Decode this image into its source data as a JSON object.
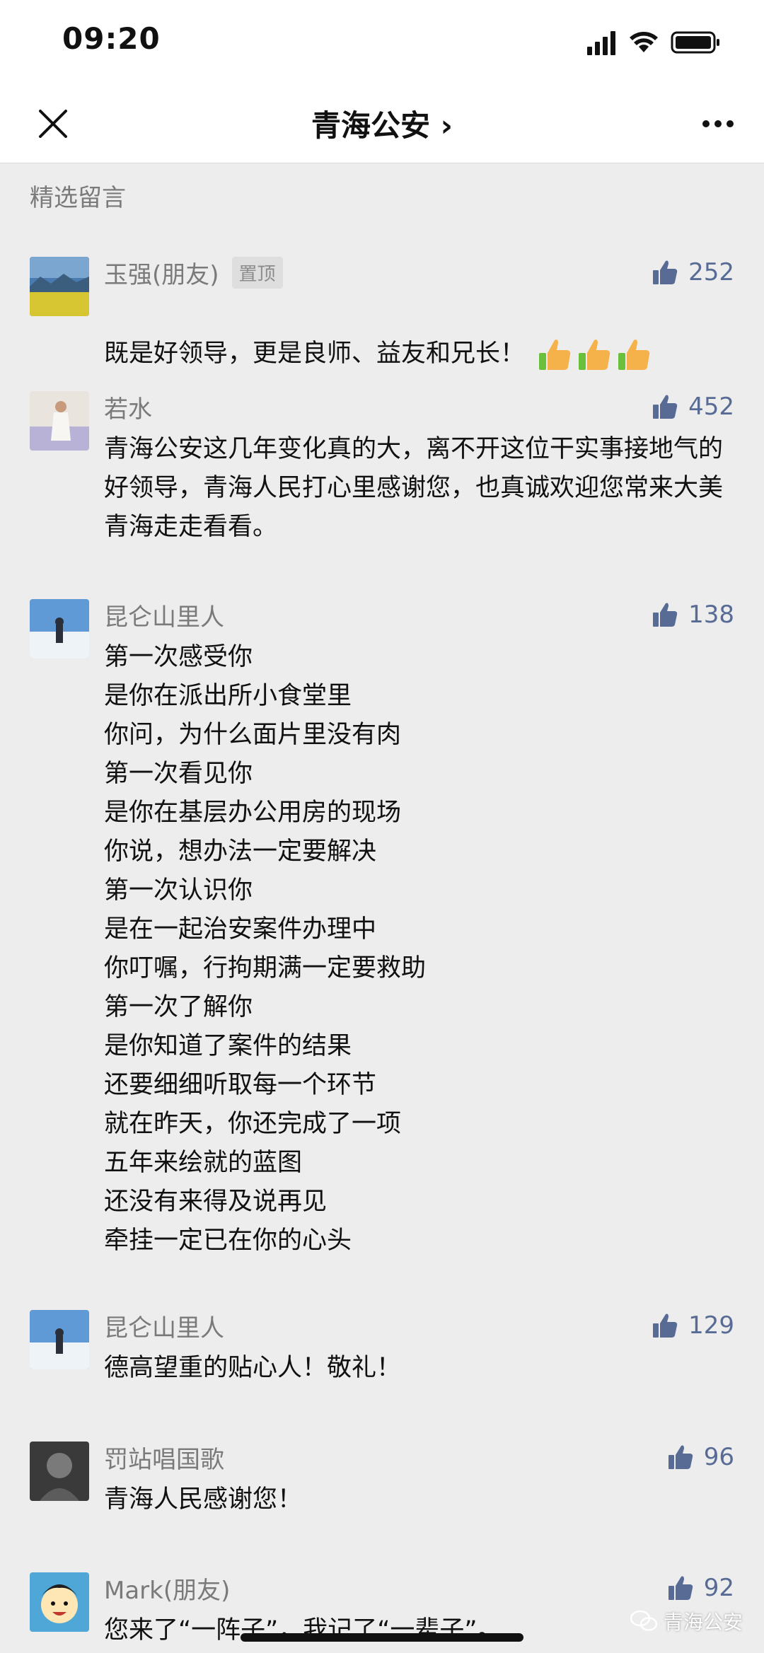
{
  "status_bar": {
    "time": "09:20"
  },
  "nav": {
    "title": "青海公安 ›"
  },
  "section_title": "精选留言",
  "comments": [
    {
      "name": "玉强(朋友)",
      "pinned": "置顶",
      "likes": "252",
      "text": "既是好领导，更是良师、益友和兄长！"
    },
    {
      "name": "若水",
      "likes": "452",
      "text": "青海公安这几年变化真的大，离不开这位干实事接地气的好领导，青海人民打心里感谢您，也真诚欢迎您常来大美青海走走看看。"
    },
    {
      "name": "昆仑山里人",
      "likes": "138",
      "text": "第一次感受你\n是你在派出所小食堂里\n你问，为什么面片里没有肉\n第一次看见你\n是你在基层办公用房的现场\n你说，想办法一定要解决\n第一次认识你\n是在一起治安案件办理中\n你叮嘱，行拘期满一定要救助\n第一次了解你\n是你知道了案件的结果\n还要细细听取每一个环节\n就在昨天，你还完成了一项\n五年来绘就的蓝图\n还没有来得及说再见\n牵挂一定已在你的心头"
    },
    {
      "name": "昆仑山里人",
      "likes": "129",
      "text": "德高望重的贴心人！敬礼！"
    },
    {
      "name": "罚站唱国歌",
      "likes": "96",
      "text": "青海人民感谢您！"
    },
    {
      "name": "Mark(朋友)",
      "likes": "92",
      "text": "您来了“一阵子”，我记了“一辈子”。"
    }
  ],
  "watermark": "青海公安",
  "colors": {
    "accent": "#576b95",
    "background": "#ededed"
  }
}
